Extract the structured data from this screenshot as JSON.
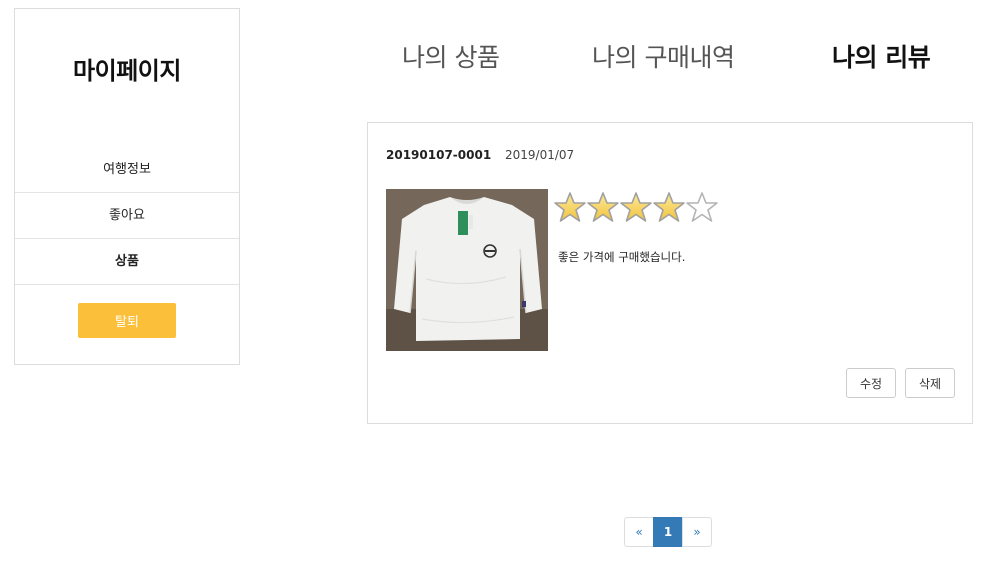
{
  "sidebar": {
    "title": "마이페이지",
    "items": [
      {
        "label": "여행정보"
      },
      {
        "label": "좋아요"
      },
      {
        "label": "상품"
      }
    ],
    "withdraw_label": "탈퇴",
    "withdraw_color": "#fbbf3a"
  },
  "tabs": [
    {
      "label": "나의 상품"
    },
    {
      "label": "나의 구매내역"
    },
    {
      "label": "나의 리뷰"
    }
  ],
  "review": {
    "order_number": "20190107-0001",
    "date": "2019/01/07",
    "rating": 4,
    "rating_max": 5,
    "text": "좋은 가격에 구매했습니다.",
    "edit_label": "수정",
    "delete_label": "삭제"
  },
  "pagination": {
    "prev": "«",
    "pages": [
      "1"
    ],
    "next": "»",
    "active_color": "#337ab7"
  }
}
